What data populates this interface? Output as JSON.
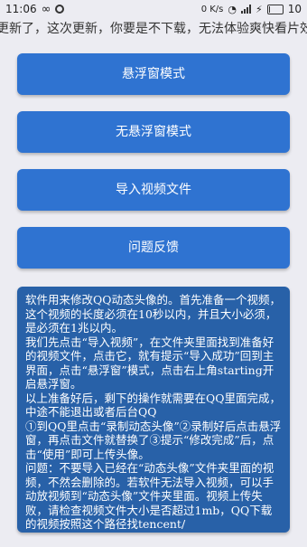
{
  "status_bar": {
    "time": "11:06",
    "network_speed": "0 K/s",
    "battery_level": "10",
    "icons": [
      "infinity-icon",
      "app-notification-icon",
      "wifi-icon",
      "signal-icon",
      "charging-bolt-icon",
      "battery-icon"
    ]
  },
  "marquee": {
    "text": "更新了，这次更新，你要是不下载，无法体验爽快看片效果"
  },
  "buttons": {
    "floating_mode": "悬浮窗模式",
    "no_floating_mode": "无悬浮窗模式",
    "import_video": "导入视频文件",
    "feedback": "问题反馈"
  },
  "info": {
    "paragraphs": [
      "软件用来修改QQ动态头像的。首先准备一个视频，这个视频的长度必须在10秒以内，并且大小必须，是必须在1兆以内。",
      "我们先点击“导入视频”，在文件夹里面找到准备好的视频文件，点击它，就有提示“导入成功”回到主界面，点击“悬浮窗”模式，点击右上角starting开启悬浮窗。",
      "以上准备好后，剩下的操作就需要在QQ里面完成，中途不能退出或者后台QQ",
      "①到QQ里点击“录制动态头像”②录制好后点击悬浮窗，再点击文件就替换了③提示“修改完成”后，点击“使用”即可上传头像。",
      "问题：不要导入已经在“动态头像”文件夹里面的视频，不然会删除的。若软件无法导入视频，可以手动放视频到“动态头像”文件夹里面。视频上传失败，请检查视频文件大小是否超过1mb，QQ下载的视频按照这个路径找tencent/"
    ]
  }
}
